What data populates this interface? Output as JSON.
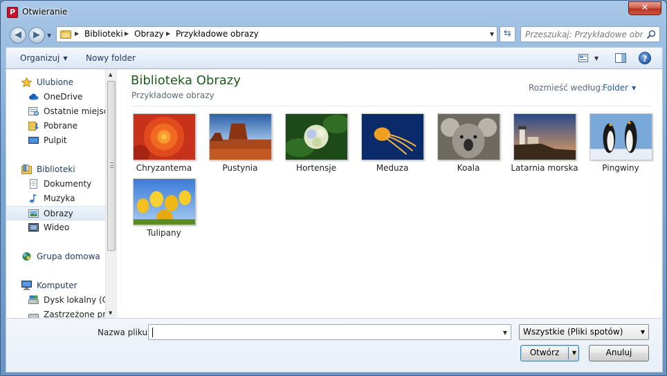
{
  "window": {
    "title": "Otwieranie",
    "app_icon_letter": "P",
    "close_glyph": "✕"
  },
  "address_bar": {
    "crumbs": [
      "Biblioteki",
      "Obrazy",
      "Przykładowe obrazy"
    ],
    "search_placeholder": "Przeszukaj: Przykładowe obrazy"
  },
  "toolbar": {
    "organize_label": "Organizuj",
    "new_folder_label": "Nowy folder",
    "help_glyph": "?"
  },
  "nav_pane": {
    "items": [
      {
        "label": "Ulubione",
        "icon": "star-icon",
        "group": true
      },
      {
        "label": "OneDrive",
        "icon": "cloud-icon"
      },
      {
        "label": "Ostatnie miejsca",
        "icon": "recent-places-icon"
      },
      {
        "label": "Pobrane",
        "icon": "downloads-folder-icon"
      },
      {
        "label": "Pulpit",
        "icon": "desktop-icon"
      },
      {
        "label": "Biblioteki",
        "icon": "libraries-icon",
        "group": true
      },
      {
        "label": "Dokumenty",
        "icon": "documents-icon"
      },
      {
        "label": "Muzyka",
        "icon": "music-icon"
      },
      {
        "label": "Obrazy",
        "icon": "pictures-icon",
        "selected": true
      },
      {
        "label": "Wideo",
        "icon": "video-icon"
      },
      {
        "label": "Grupa domowa",
        "icon": "homegroup-icon",
        "group": true
      },
      {
        "label": "Komputer",
        "icon": "computer-icon",
        "group": true
      },
      {
        "label": "Dysk lokalny (C:)",
        "icon": "local-disk-icon"
      },
      {
        "label": "Zastrzeżone przez",
        "icon": "reserved-drive-icon"
      }
    ]
  },
  "files_pane": {
    "library_title": "Biblioteka Obrazy",
    "library_subtitle": "Przykładowe obrazy",
    "arrange_label": "Rozmieść według:",
    "arrange_value": "Folder",
    "files": [
      {
        "name": "Chryzantema"
      },
      {
        "name": "Pustynia"
      },
      {
        "name": "Hortensje"
      },
      {
        "name": "Meduza"
      },
      {
        "name": "Koala"
      },
      {
        "name": "Latarnia morska"
      },
      {
        "name": "Pingwiny"
      },
      {
        "name": "Tulipany"
      }
    ]
  },
  "bottom": {
    "filename_label": "Nazwa pliku:",
    "filename_value": "",
    "filetype_value": "Wszystkie (Pliki spotów)",
    "open_label": "Otwórz",
    "cancel_label": "Anuluj"
  },
  "colors": {
    "library_title": "#1e5a1e",
    "link_blue": "#1e5ea0",
    "close_red": "#c43a23"
  }
}
